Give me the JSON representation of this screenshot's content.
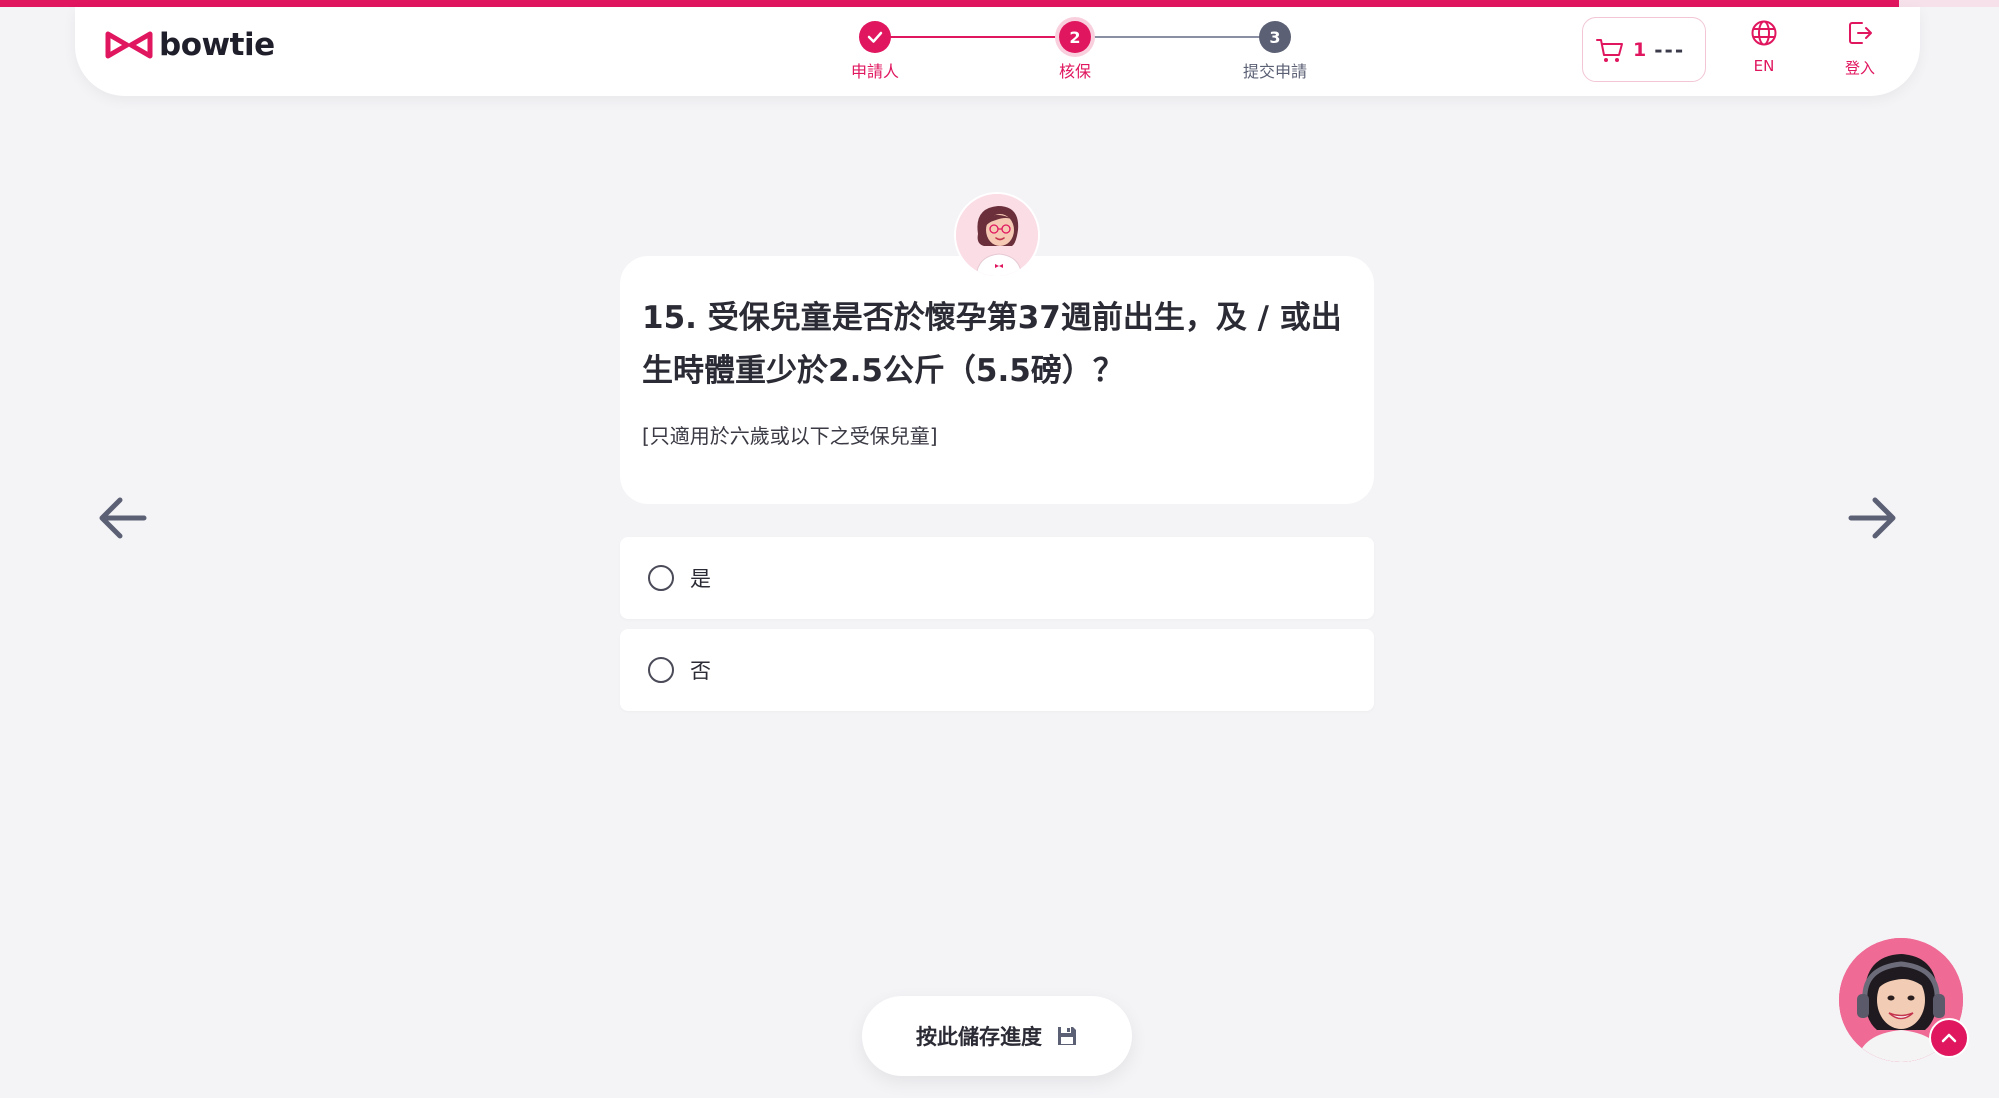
{
  "brand": {
    "name": "bowtie",
    "accent": "#e0165f",
    "progress": 0.95
  },
  "stepper": {
    "steps": [
      {
        "number": "",
        "label": "申請人",
        "status": "done"
      },
      {
        "number": "2",
        "label": "核保",
        "status": "current"
      },
      {
        "number": "3",
        "label": "提交申請",
        "status": "todo"
      }
    ]
  },
  "header": {
    "cart": {
      "icon": "cart-icon",
      "count": "1",
      "amount": "---"
    },
    "language": {
      "icon": "globe-icon",
      "label": "EN"
    },
    "login": {
      "icon": "login-icon",
      "label": "登入"
    }
  },
  "question": {
    "title": "15. 受保兒童是否於懷孕第37週前出生，及 / 或出生時體重少於2.5公斤（5.5磅）？",
    "note": "[只適用於六歲或以下之受保兒童]",
    "options": [
      {
        "label": "是",
        "selected": false
      },
      {
        "label": "否",
        "selected": false
      }
    ]
  },
  "navigation": {
    "prev_icon": "arrow-left-icon",
    "next_icon": "arrow-right-icon"
  },
  "save": {
    "label": "按此儲存進度",
    "icon": "floppy-disk-icon"
  },
  "chat": {
    "icon": "chevron-up-icon"
  }
}
